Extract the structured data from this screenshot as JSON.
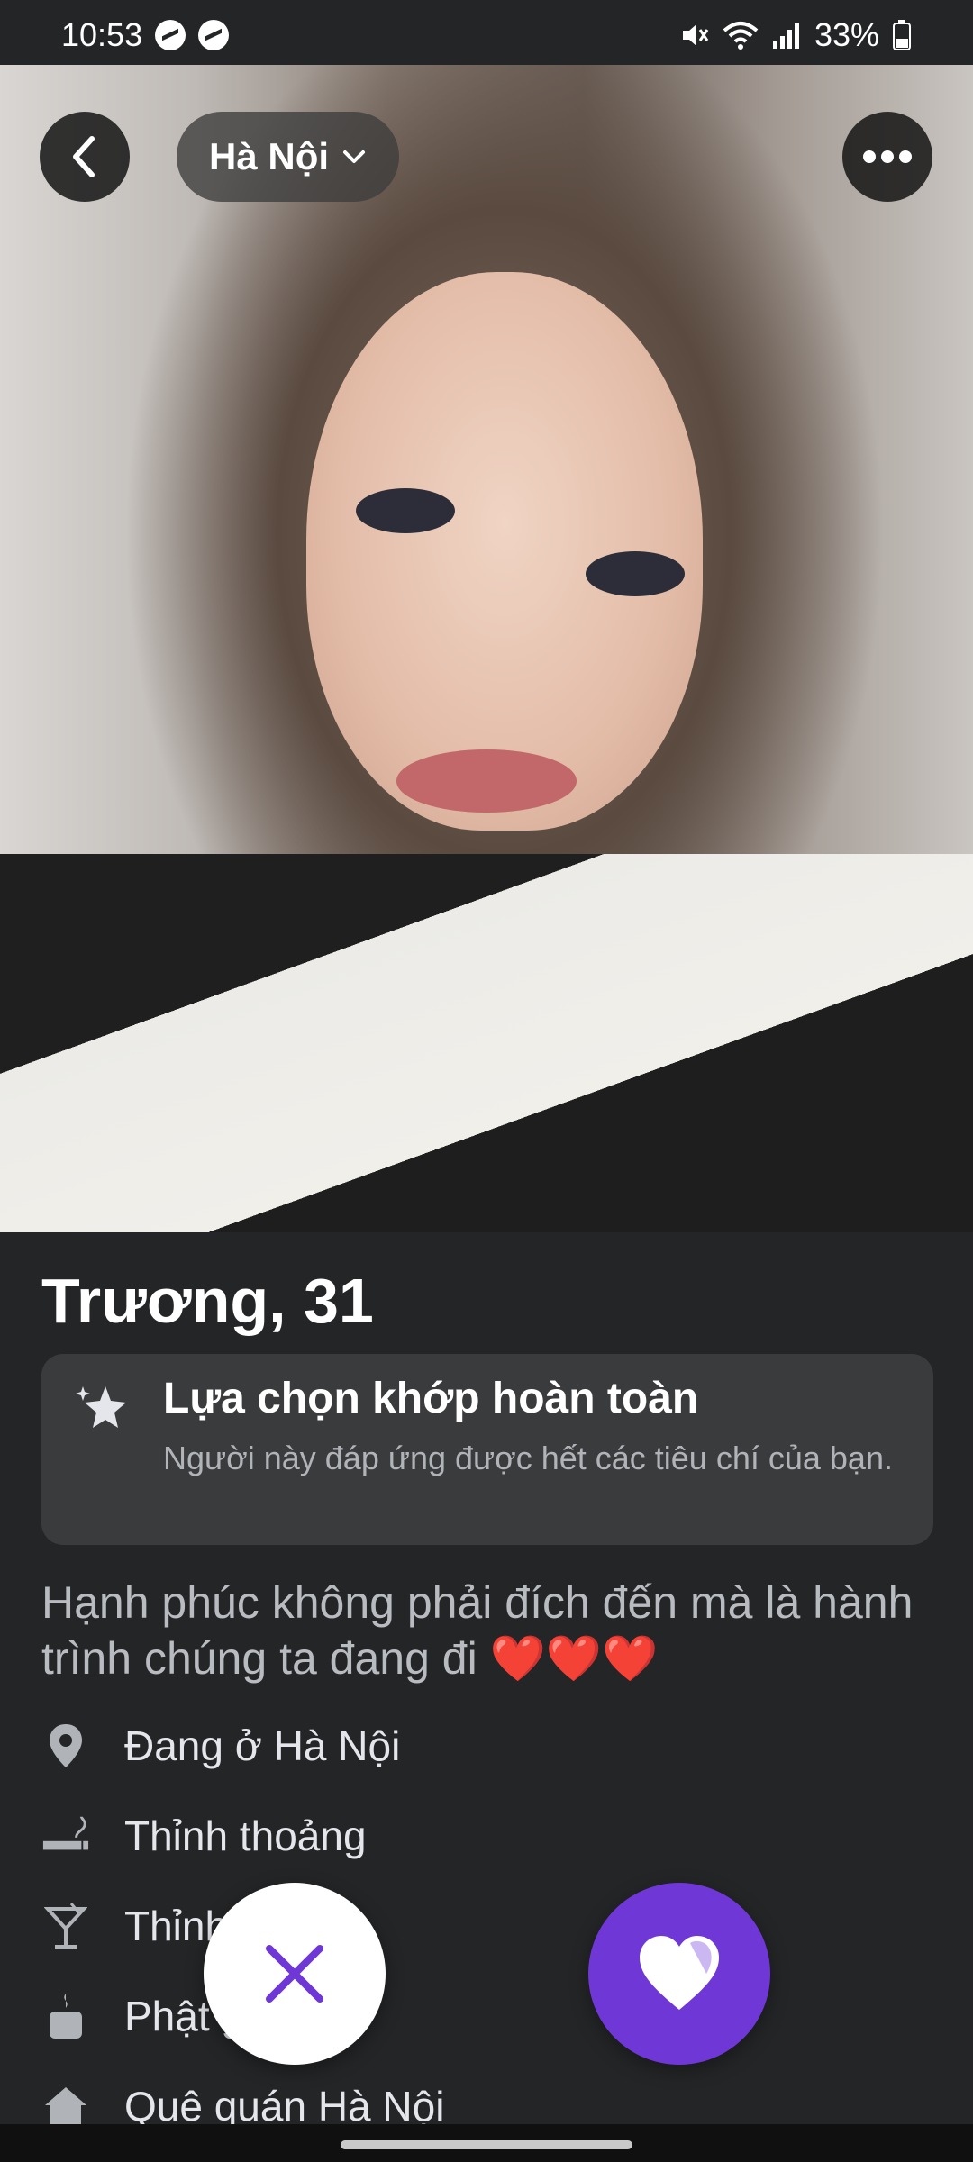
{
  "status_bar": {
    "time": "10:53",
    "battery": "33%"
  },
  "header": {
    "location_label": "Hà Nội"
  },
  "profile": {
    "name_age": "Trương, 31",
    "match": {
      "title": "Lựa chọn khớp hoàn toàn",
      "description": "Người này đáp ứng được hết các tiêu chí của bạn."
    },
    "bio": "Hạnh phúc không phải đích đến mà là hành trình chúng ta đang đi",
    "bio_emoji": "❤️❤️❤️",
    "details": [
      {
        "icon": "location-pin-icon",
        "text": "Đang ở Hà Nội"
      },
      {
        "icon": "smoking-icon",
        "text": "Thỉnh thoảng"
      },
      {
        "icon": "cocktail-icon",
        "text": "Thỉnh thoảng"
      },
      {
        "icon": "candle-icon",
        "text": "Phật giáo"
      },
      {
        "icon": "home-icon",
        "text": "Quê quán Hà Nội"
      }
    ]
  },
  "colors": {
    "background": "#242526",
    "card": "#3a3b3c",
    "like_button": "#6f37d6",
    "heart": "#e8283c"
  }
}
